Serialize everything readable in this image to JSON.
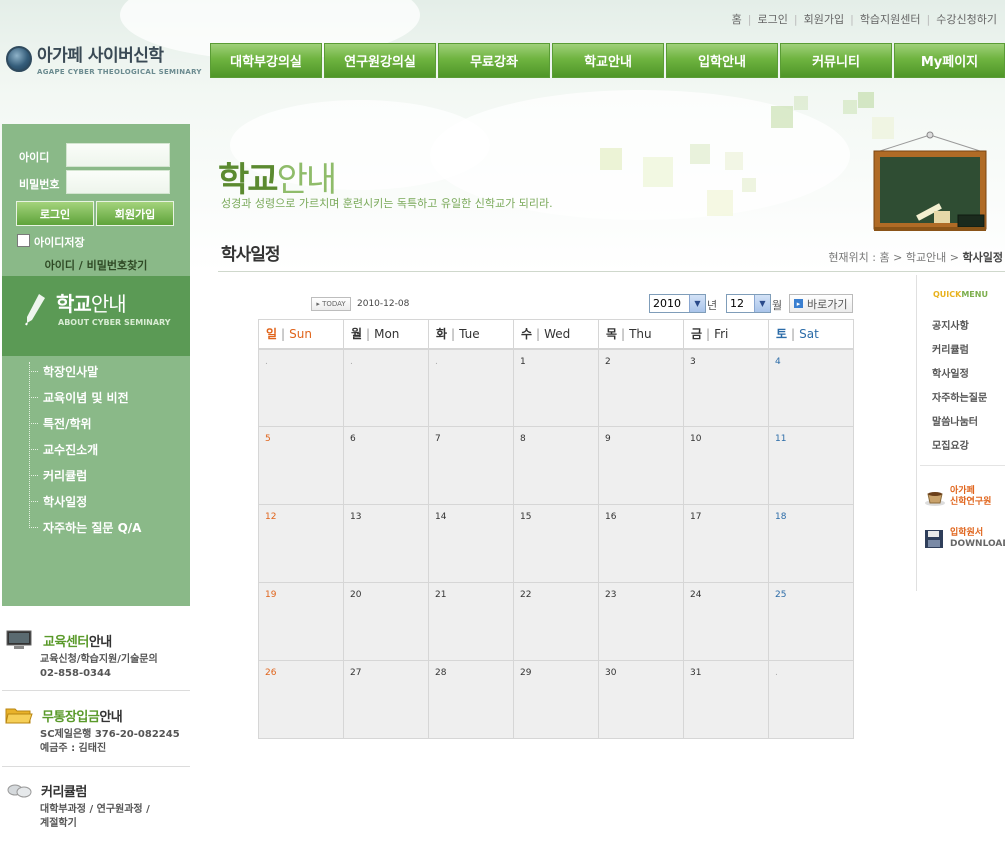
{
  "top_links": [
    "홈",
    "로그인",
    "회원가입",
    "학습지원센터",
    "수강신청하기"
  ],
  "logo": {
    "title": "아가페 사이버신학",
    "subtitle": "AGAPE CYBER THEOLOGICAL SEMINARY"
  },
  "main_nav": [
    "대학부강의실",
    "연구원강의실",
    "무료강좌",
    "학교안내",
    "입학안내",
    "커뮤니티",
    "My페이지"
  ],
  "login": {
    "id_label": "아이디",
    "pw_label": "비밀번호",
    "login_button": "로그인",
    "join_button": "회원가입",
    "save_id_label": "아이디저장",
    "find_link": "아이디 / 비밀번호찾기"
  },
  "section": {
    "title_bold": "학교",
    "title_light": "안내",
    "subtitle": "ABOUT CYBER SEMINARY"
  },
  "side_menu": [
    "학장인사말",
    "교육이념 및 비전",
    "특전/학위",
    "교수진소개",
    "커리큘럼",
    "학사일정",
    "자주하는 질문 Q/A"
  ],
  "info": {
    "edu": {
      "title_green": "교육센터",
      "title_rest": "안내",
      "line1": "교육신청/학습지원/기술문의",
      "line2": "02-858-0344"
    },
    "bank": {
      "title_green": "무통장입금",
      "title_rest": "안내",
      "line1": "SC제일은행 376-20-082245",
      "line2": "예금주 : 김태진"
    },
    "curr": {
      "title": "커리큘럼",
      "line1": "대학부과정 / 연구원과정 /",
      "line2": "계절학기"
    }
  },
  "page_heading": {
    "bold": "학교",
    "light": "안내",
    "description": "성경과 성령으로 가르치며 훈련시키는 독특하고 유일한 신학교가 되리라."
  },
  "page_title": "학사일정",
  "breadcrumb": {
    "prefix": "현재위치 : 홈 > 학교안내 > ",
    "current": "학사일정"
  },
  "calendar_controls": {
    "today_button": "TODAY",
    "today_date": "2010-12-08",
    "year": "2010",
    "year_unit": "년",
    "month": "12",
    "month_unit": "월",
    "go_button": "바로가기"
  },
  "calendar": {
    "headers": [
      {
        "ko": "일",
        "en": "Sun"
      },
      {
        "ko": "월",
        "en": "Mon"
      },
      {
        "ko": "화",
        "en": "Tue"
      },
      {
        "ko": "수",
        "en": "Wed"
      },
      {
        "ko": "목",
        "en": "Thu"
      },
      {
        "ko": "금",
        "en": "Fri"
      },
      {
        "ko": "토",
        "en": "Sat"
      }
    ],
    "weeks": [
      [
        ".",
        ".",
        ".",
        "1",
        "2",
        "3",
        "4"
      ],
      [
        "5",
        "6",
        "7",
        "8",
        "9",
        "10",
        "11"
      ],
      [
        "12",
        "13",
        "14",
        "15",
        "16",
        "17",
        "18"
      ],
      [
        "19",
        "20",
        "21",
        "22",
        "23",
        "24",
        "25"
      ],
      [
        "26",
        "27",
        "28",
        "29",
        "30",
        "31",
        "."
      ]
    ]
  },
  "quick_menu": {
    "title_q": "QUICK",
    "title_m": "MENU",
    "items": [
      "공지사항",
      "커리큘럼",
      "학사일정",
      "자주하는질문",
      "말씀나눔터",
      "모집요강"
    ],
    "banner1": {
      "line1": "아가페",
      "line2": "신학연구원"
    },
    "banner2": {
      "line1": "입학원서",
      "line2": "DOWNLOAD"
    }
  },
  "colors": {
    "green_nav": "#6fb440",
    "side_green": "#8ab988",
    "sunday": "#e0641b",
    "saturday": "#2c6ca8"
  }
}
